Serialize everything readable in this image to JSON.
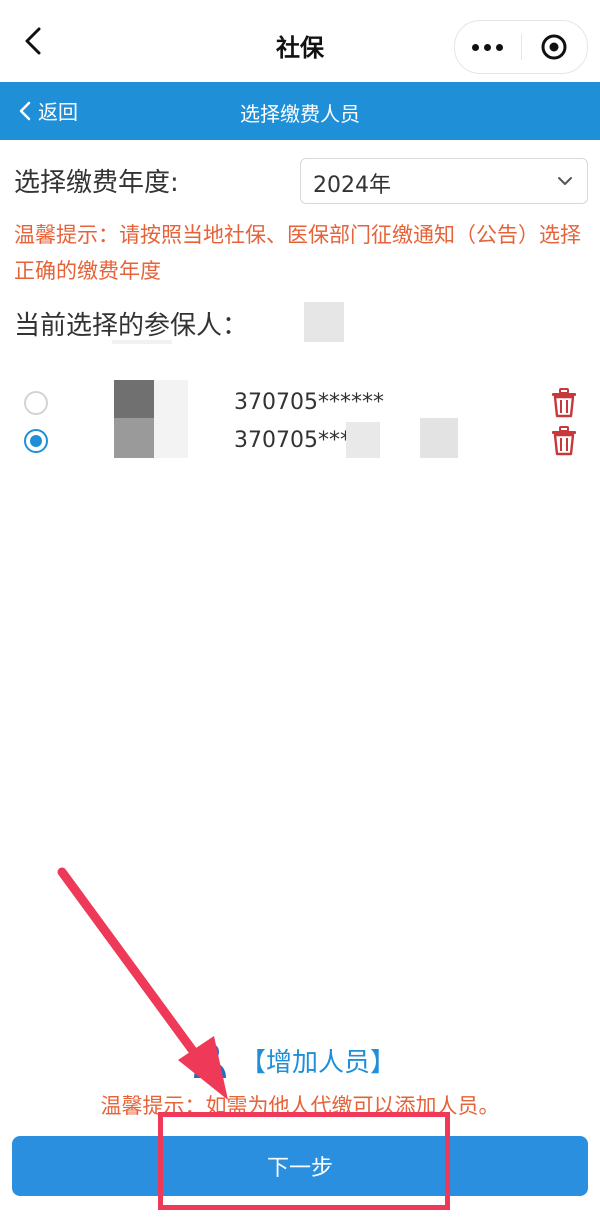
{
  "topbar": {
    "title": "社保",
    "back_icon": "chevron-left-icon",
    "more_icon": "more-dots-icon",
    "close_icon": "target-circle-icon"
  },
  "header": {
    "back_label": "返回",
    "title": "选择缴费人员"
  },
  "year": {
    "label": "选择缴费年度:",
    "value": "2024年"
  },
  "tip_text": "温馨提示：请按照当地社保、医保部门征缴通知（公告）选择正确的缴费年度",
  "current_label": "当前选择的参保人：",
  "persons": [
    {
      "id_text": "370705******",
      "selected": false
    },
    {
      "id_text": "370705*****",
      "selected": true
    }
  ],
  "add_person_label": "【增加人员】",
  "bottom_tip": "温馨提示：如需为他人代缴可以添加人员。",
  "next_button_label": "下一步",
  "colors": {
    "primary_blue": "#1f8fd8",
    "warning_orange": "#e6633a",
    "delete_red": "#c8383b",
    "annotation_red": "#ee3a58"
  }
}
